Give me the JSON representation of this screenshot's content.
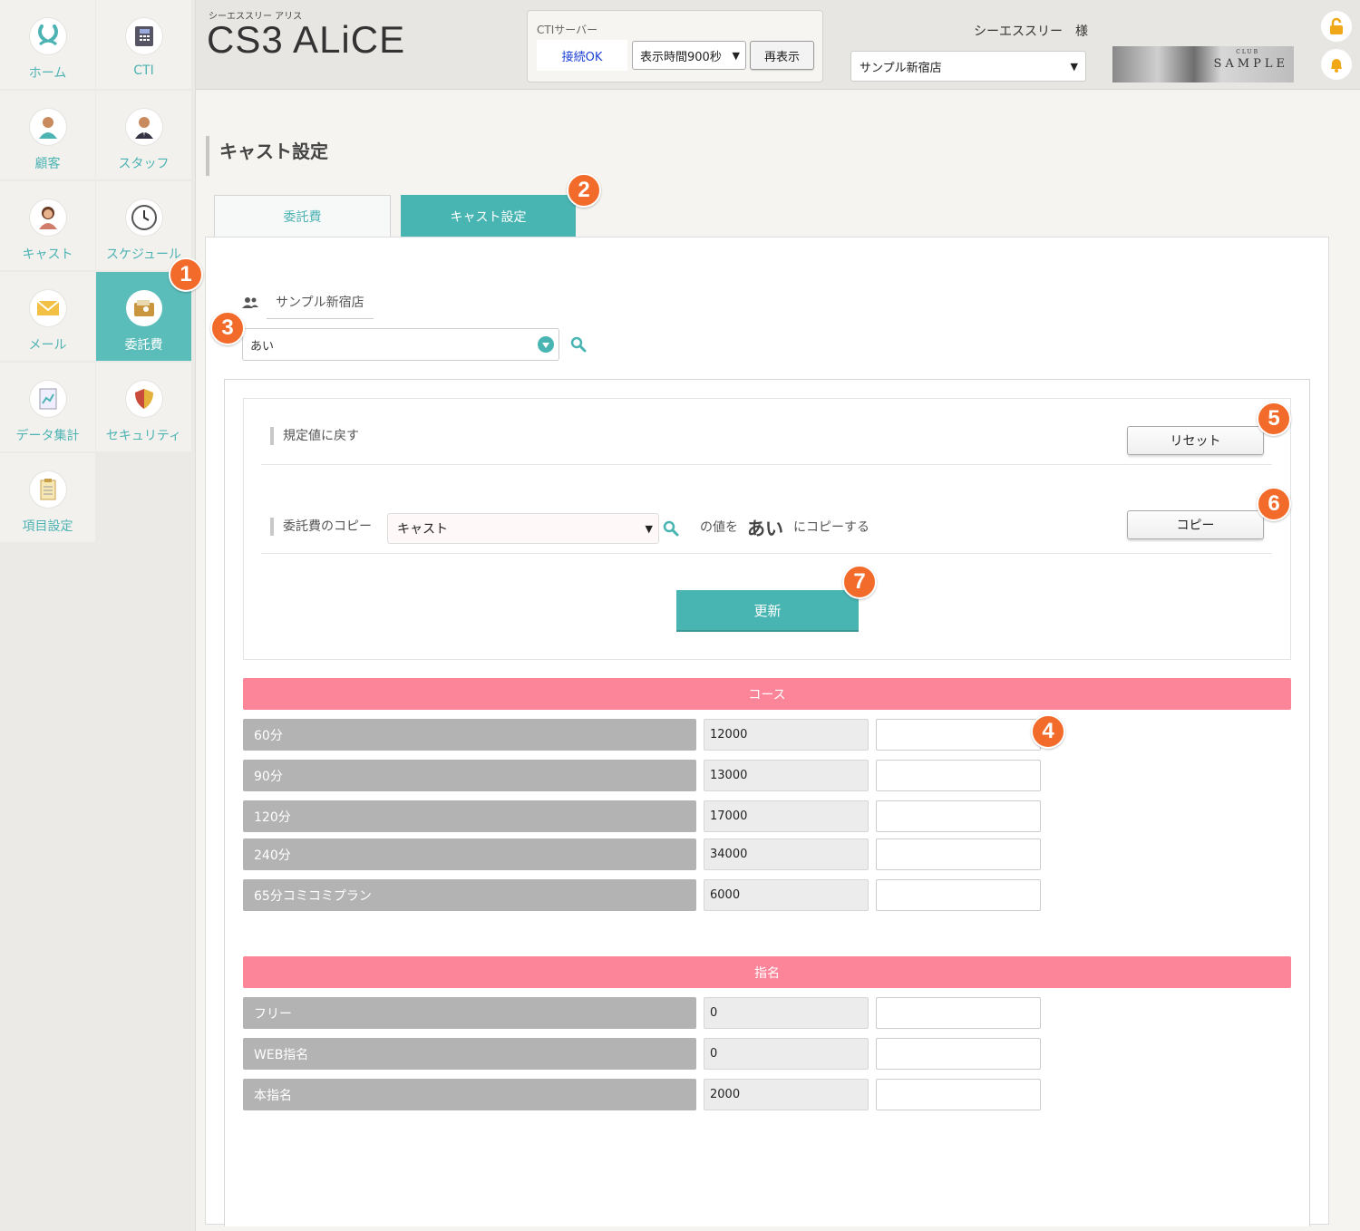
{
  "sidebar": {
    "items": [
      {
        "label": "ホーム",
        "icon": "rabbit-logo-icon"
      },
      {
        "label": "CTI",
        "icon": "phone-icon"
      },
      {
        "label": "顧客",
        "icon": "customer-icon"
      },
      {
        "label": "スタッフ",
        "icon": "staff-icon"
      },
      {
        "label": "キャスト",
        "icon": "cast-icon"
      },
      {
        "label": "スケジュール",
        "icon": "clock-icon"
      },
      {
        "label": "メール",
        "icon": "mail-icon"
      },
      {
        "label": "委託費",
        "icon": "wallet-icon"
      },
      {
        "label": "データ集計",
        "icon": "report-icon"
      },
      {
        "label": "セキュリティ",
        "icon": "shield-icon"
      },
      {
        "label": "項目設定",
        "icon": "clipboard-icon"
      }
    ]
  },
  "header": {
    "brand_sub": "シーエススリー アリス",
    "brand": "CS3 ALiCE",
    "cti": {
      "title": "CTIサーバー",
      "status": "接続OK",
      "display_time": "表示時間900秒",
      "refresh_button": "再表示"
    },
    "user_name": "シーエススリー　様",
    "store_select": "サンプル新宿店",
    "logo": {
      "club": "CLUB",
      "name": "SAMPLE"
    }
  },
  "page": {
    "title": "キャスト設定",
    "tabs": [
      "委託費",
      "キャスト設定"
    ],
    "store_name": "サンプル新宿店",
    "cast_value": "あい"
  },
  "settings": {
    "reset_label": "規定値に戻す",
    "reset_button": "リセット",
    "copy_label": "委託費のコピー",
    "copy_select": "キャスト",
    "copy_text_1": "の値を",
    "copy_name": "あい",
    "copy_text_2": "にコピーする",
    "copy_button": "コピー",
    "update_button": "更新"
  },
  "sections": [
    {
      "title": "コース",
      "rows": [
        {
          "name": "60分",
          "default": "12000",
          "value": ""
        },
        {
          "name": "90分",
          "default": "13000",
          "value": ""
        },
        {
          "name": "120分",
          "default": "17000",
          "value": ""
        },
        {
          "name": "240分",
          "default": "34000",
          "value": ""
        },
        {
          "name": "65分コミコミプラン",
          "default": "6000",
          "value": ""
        }
      ]
    },
    {
      "title": "指名",
      "rows": [
        {
          "name": "フリー",
          "default": "0",
          "value": ""
        },
        {
          "name": "WEB指名",
          "default": "0",
          "value": ""
        },
        {
          "name": "本指名",
          "default": "2000",
          "value": ""
        }
      ]
    }
  ],
  "badges": [
    "1",
    "2",
    "3",
    "4",
    "5",
    "6",
    "7"
  ],
  "colors": {
    "accent": "#48b5b2",
    "section": "#fd8599",
    "badge": "#f26b2a",
    "row_label": "#b3b3b3"
  }
}
